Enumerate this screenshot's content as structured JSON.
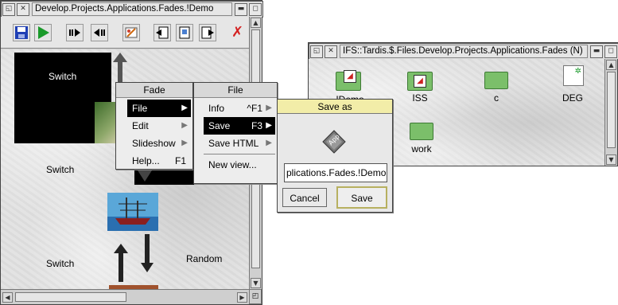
{
  "left_window": {
    "title": "Develop.Projects.Applications.Fades.!Demo",
    "slides": {
      "switch_1": "Switch",
      "switch_2": "Switch",
      "switch_3": "Switch",
      "random": "Random"
    }
  },
  "fade_menu": {
    "title": "Fade",
    "items": [
      {
        "label": "File"
      },
      {
        "label": "Edit"
      },
      {
        "label": "Slideshow"
      },
      {
        "label": "Help...",
        "shortcut": "F1"
      }
    ]
  },
  "file_menu": {
    "title": "File",
    "items": [
      {
        "label": "Info",
        "shortcut": "^F1"
      },
      {
        "label": "Save",
        "shortcut": "F3"
      },
      {
        "label": "Save HTML"
      },
      {
        "label": "New view..."
      }
    ]
  },
  "save_dialog": {
    "title": "Save as",
    "icon_label": "App",
    "filename": "plications.Fades.!Demo",
    "cancel_label": "Cancel",
    "save_label": "Save"
  },
  "filer_window": {
    "title": "IFS::Tardis.$.Files.Develop.Projects.Applications.Fades (N)",
    "items": [
      {
        "name": "!Demo",
        "type": "application"
      },
      {
        "name": "ISS",
        "type": "application"
      },
      {
        "name": "c",
        "type": "directory"
      },
      {
        "name": "DEG",
        "type": "basic-file"
      },
      {
        "name": "work",
        "type": "directory"
      }
    ]
  },
  "colors": {
    "selection": "#000000",
    "folder_green": "#7bbf6a",
    "save_icon_blue": "#1f3fb5",
    "run_icon_green": "#1a9a2a",
    "close_icon_red": "#d42020"
  }
}
